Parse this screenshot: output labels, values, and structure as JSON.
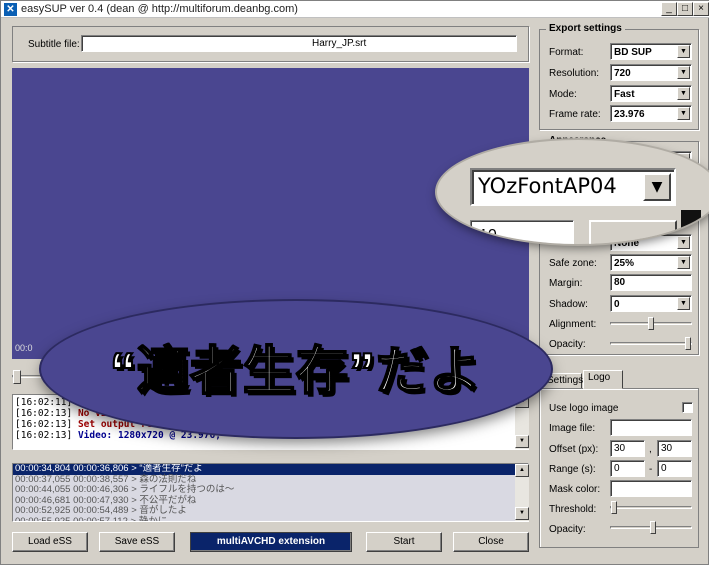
{
  "window": {
    "title": "easySUP ver 0.4 (dean @ http://multiforum.deanbg.com)",
    "app_icon": "x-logo-icon",
    "min": "_",
    "max": "□",
    "close": "×"
  },
  "subtitle": {
    "label": "Subtitle file:",
    "value": "Harry_JP.srt"
  },
  "preview": {
    "time_fragment": "00:0",
    "overlay_text": "“適者生存”だよ"
  },
  "log": {
    "lines": [
      {
        "time": "[16:02:11]",
        "msg": "",
        "color": "#000000"
      },
      {
        "time": "[16:02:13]",
        "msg": "No vi",
        "color": "#a00000"
      },
      {
        "time": "[16:02:13]",
        "msg": "Set output re",
        "color": "#a00000"
      },
      {
        "time": "[16:02:13]",
        "msg": "Video: 1280x720 @ 23.976, ",
        "color": "#000090"
      }
    ]
  },
  "list": {
    "rows": [
      "00:00:34,804 00:00:36,806 > “適者生存”だよ",
      "00:00:37,055 00:00:38,557 > 森の法則だね",
      "00:00:44,055 00:00:46,306 > ライフルを持つのは～",
      "00:00:46,681 00:00:47,930 > 不公平だがね",
      "00:00:52,925 00:00:54,489 > 音がしたよ",
      "00:00:55,925 00:00:57,112 > 静かに"
    ]
  },
  "buttons": {
    "load": "Load eSS",
    "save": "Save eSS",
    "multi": "multiAVCHD extension",
    "start": "Start",
    "close": "Close"
  },
  "export": {
    "title": "Export settings",
    "format_label": "Format:",
    "format": "BD SUP",
    "resolution_label": "Resolution:",
    "resolution": "720",
    "mode_label": "Mode:",
    "mode": "Fast",
    "framerate_label": "Frame rate:",
    "framerate": "23.976"
  },
  "appearance": {
    "title": "Appearance",
    "font": "YOzFontAP04",
    "font_size": "10",
    "border": "None",
    "safezone_label": "Safe zone:",
    "safezone": "25%",
    "margin_label": "Margin:",
    "margin": "80",
    "shadow_label": "Shadow:",
    "shadow": "0",
    "alignment_label": "Alignment:",
    "opacity_label": "Opacity:"
  },
  "tabs": {
    "settings": "Settings",
    "logo": "Logo"
  },
  "logo": {
    "use_label": "Use logo image",
    "image_label": "Image file:",
    "offset_label": "Offset (px):",
    "offset_x": "30",
    "offset_sep": ",",
    "offset_y": "30",
    "range_label": "Range (s):",
    "range_from": "0",
    "range_sep": "-",
    "range_to": "0",
    "mask_label": "Mask color:",
    "threshold_label": "Threshold:",
    "opacity_label": "Opacity:"
  }
}
